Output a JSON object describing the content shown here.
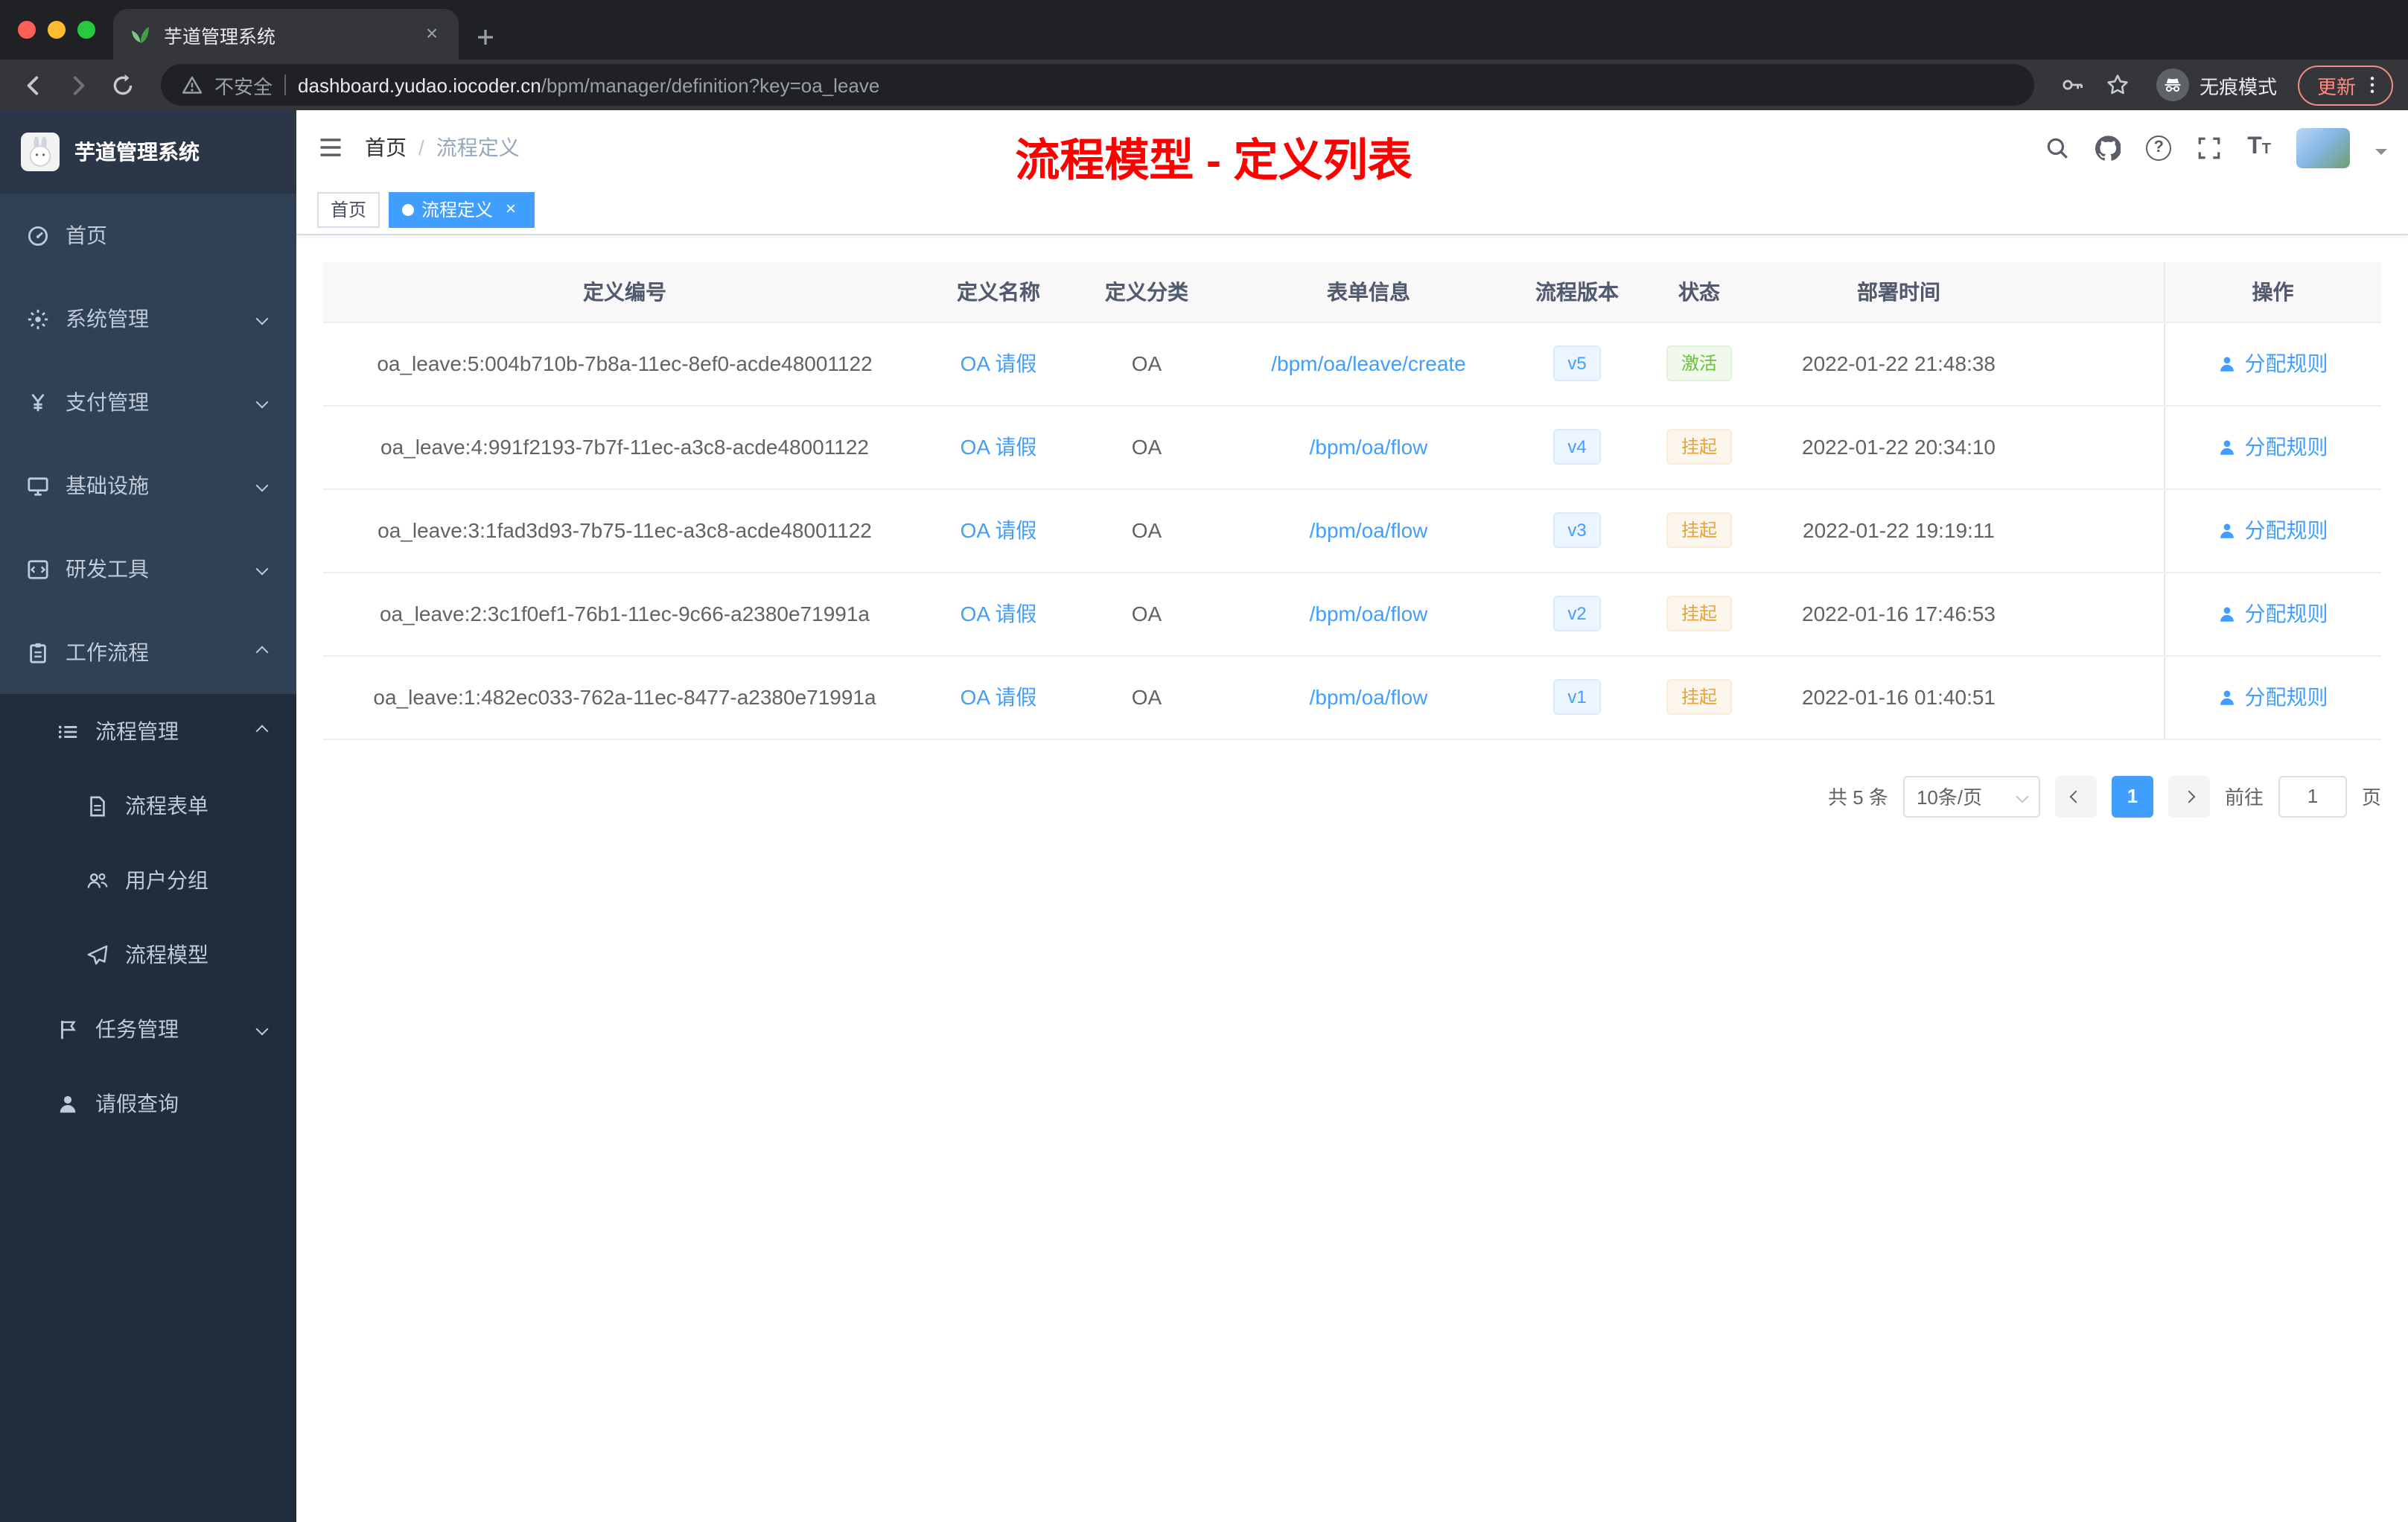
{
  "colors": {
    "accent": "#409eff",
    "success": "#67c23a",
    "warning": "#e6a23c",
    "annotation": "#ff0000",
    "sidebar_bg": "#304156",
    "submenu_bg": "#1f2d3d"
  },
  "browser": {
    "tab_title": "芋道管理系统",
    "security_label": "不安全",
    "url_domain": "dashboard.yudao.iocoder.cn",
    "url_path": "/bpm/manager/definition?key=oa_leave",
    "incognito_label": "无痕模式",
    "update_label": "更新"
  },
  "sidebar": {
    "app_title": "芋道管理系统",
    "items": [
      {
        "label": "首页"
      },
      {
        "label": "系统管理"
      },
      {
        "label": "支付管理"
      },
      {
        "label": "基础设施"
      },
      {
        "label": "研发工具"
      },
      {
        "label": "工作流程"
      },
      {
        "label": "流程管理"
      },
      {
        "label": "流程表单"
      },
      {
        "label": "用户分组"
      },
      {
        "label": "流程模型"
      },
      {
        "label": "任务管理"
      },
      {
        "label": "请假查询"
      }
    ]
  },
  "header": {
    "breadcrumb_home": "首页",
    "breadcrumb_separator": "/",
    "breadcrumb_current": "流程定义",
    "annotation": "流程模型 - 定义列表"
  },
  "tags": [
    {
      "label": "首页",
      "active": false
    },
    {
      "label": "流程定义",
      "active": true
    }
  ],
  "table": {
    "columns": [
      "定义编号",
      "定义名称",
      "定义分类",
      "表单信息",
      "流程版本",
      "状态",
      "部署时间",
      "操作"
    ],
    "rows": [
      {
        "id": "oa_leave:5:004b710b-7b8a-11ec-8ef0-acde48001122",
        "name": "OA 请假",
        "category": "OA",
        "form": "/bpm/oa/leave/create",
        "version": "v5",
        "status": "激活",
        "status_type": "success",
        "deploy_time": "2022-01-22 21:48:38",
        "action": "分配规则"
      },
      {
        "id": "oa_leave:4:991f2193-7b7f-11ec-a3c8-acde48001122",
        "name": "OA 请假",
        "category": "OA",
        "form": "/bpm/oa/flow",
        "version": "v4",
        "status": "挂起",
        "status_type": "warning",
        "deploy_time": "2022-01-22 20:34:10",
        "action": "分配规则"
      },
      {
        "id": "oa_leave:3:1fad3d93-7b75-11ec-a3c8-acde48001122",
        "name": "OA 请假",
        "category": "OA",
        "form": "/bpm/oa/flow",
        "version": "v3",
        "status": "挂起",
        "status_type": "warning",
        "deploy_time": "2022-01-22 19:19:11",
        "action": "分配规则"
      },
      {
        "id": "oa_leave:2:3c1f0ef1-76b1-11ec-9c66-a2380e71991a",
        "name": "OA 请假",
        "category": "OA",
        "form": "/bpm/oa/flow",
        "version": "v2",
        "status": "挂起",
        "status_type": "warning",
        "deploy_time": "2022-01-16 17:46:53",
        "action": "分配规则"
      },
      {
        "id": "oa_leave:1:482ec033-762a-11ec-8477-a2380e71991a",
        "name": "OA 请假",
        "category": "OA",
        "form": "/bpm/oa/flow",
        "version": "v1",
        "status": "挂起",
        "status_type": "warning",
        "deploy_time": "2022-01-16 01:40:51",
        "action": "分配规则"
      }
    ]
  },
  "pagination": {
    "total": "共 5 条",
    "page_size": "10条/页",
    "current_page": "1",
    "goto_label": "前往",
    "goto_value": "1",
    "page_unit": "页"
  }
}
